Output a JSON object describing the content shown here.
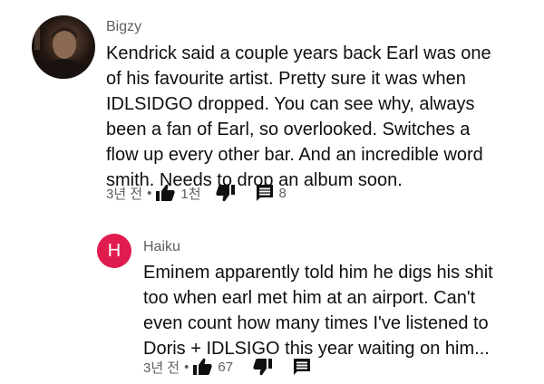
{
  "comments": [
    {
      "author": "Bigzy",
      "avatar": {
        "type": "photo",
        "icon": "user-photo"
      },
      "lines": [
        "Kendrick said a couple years back Earl was one",
        "of his favourite artist. Pretty sure it was when",
        "IDLSIDGO dropped. You can see why, always",
        "been a fan of Earl, so overlooked. Switches a",
        "flow up every other bar. And an incredible word",
        "smith. Needs to drop an album soon."
      ],
      "time": "3년 전",
      "likes": "1천",
      "replies": "8"
    },
    {
      "author": "Haiku",
      "avatar": {
        "type": "letter",
        "letter": "H",
        "color": "#e01b4e"
      },
      "lines": [
        "Eminem apparently told him he digs his shit",
        "too when earl met him at an airport. Can't",
        "even count how many times I've listened to",
        "Doris + IDLSIGO this year waiting on him..."
      ],
      "time": "3년 전",
      "likes": "67"
    }
  ],
  "separator": "•",
  "icons": [
    "thumbs-up-icon",
    "thumbs-down-icon",
    "comment-icon"
  ]
}
